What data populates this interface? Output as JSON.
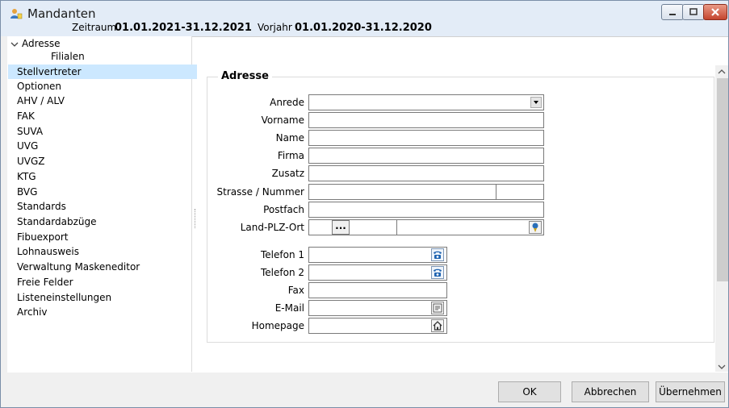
{
  "window": {
    "title": "Mandanten",
    "zeitraum_label": "Zeitraum",
    "zeitraum_value": "01.01.2021-31.12.2021",
    "vorjahr_label": "Vorjahr",
    "vorjahr_value": "01.01.2020-31.12.2020"
  },
  "tree": {
    "items": [
      {
        "label": "Adresse",
        "expanded": true
      },
      {
        "label": "Filialen"
      },
      {
        "label": "Stellvertreter",
        "selected": true
      },
      {
        "label": "Optionen"
      },
      {
        "label": "AHV / ALV"
      },
      {
        "label": "FAK"
      },
      {
        "label": "SUVA"
      },
      {
        "label": "UVG"
      },
      {
        "label": "UVGZ"
      },
      {
        "label": "KTG"
      },
      {
        "label": "BVG"
      },
      {
        "label": "Standards"
      },
      {
        "label": "Standardabzüge"
      },
      {
        "label": "Fibuexport"
      },
      {
        "label": "Lohnausweis"
      },
      {
        "label": "Verwaltung Maskeneditor"
      },
      {
        "label": "Freie Felder"
      },
      {
        "label": "Listeneinstellungen"
      },
      {
        "label": "Archiv"
      }
    ]
  },
  "form": {
    "group_title": "Adresse",
    "anrede_label": "Anrede",
    "anrede_value": "",
    "vorname_label": "Vorname",
    "vorname_value": "",
    "name_label": "Name",
    "name_value": "",
    "firma_label": "Firma",
    "firma_value": "",
    "zusatz_label": "Zusatz",
    "zusatz_value": "",
    "strasse_label": "Strasse / Nummer",
    "strasse_value": "",
    "nummer_value": "",
    "postfach_label": "Postfach",
    "postfach_value": "",
    "landplzort_label": "Land-PLZ-Ort",
    "lookup_button_label": "...",
    "plz_value": "",
    "ort_value": "",
    "telefon1_label": "Telefon 1",
    "telefon1_value": "",
    "telefon2_label": "Telefon 2",
    "telefon2_value": "",
    "fax_label": "Fax",
    "fax_value": "",
    "email_label": "E-Mail",
    "email_value": "",
    "homepage_label": "Homepage",
    "homepage_value": ""
  },
  "buttons": {
    "ok": "OK",
    "cancel": "Abbrechen",
    "apply": "Übernehmen"
  },
  "icons": {
    "title": "mandanten-icon",
    "phone": "phone-icon",
    "email": "email-icon",
    "homepage": "home-icon",
    "location": "location-pin-icon"
  }
}
